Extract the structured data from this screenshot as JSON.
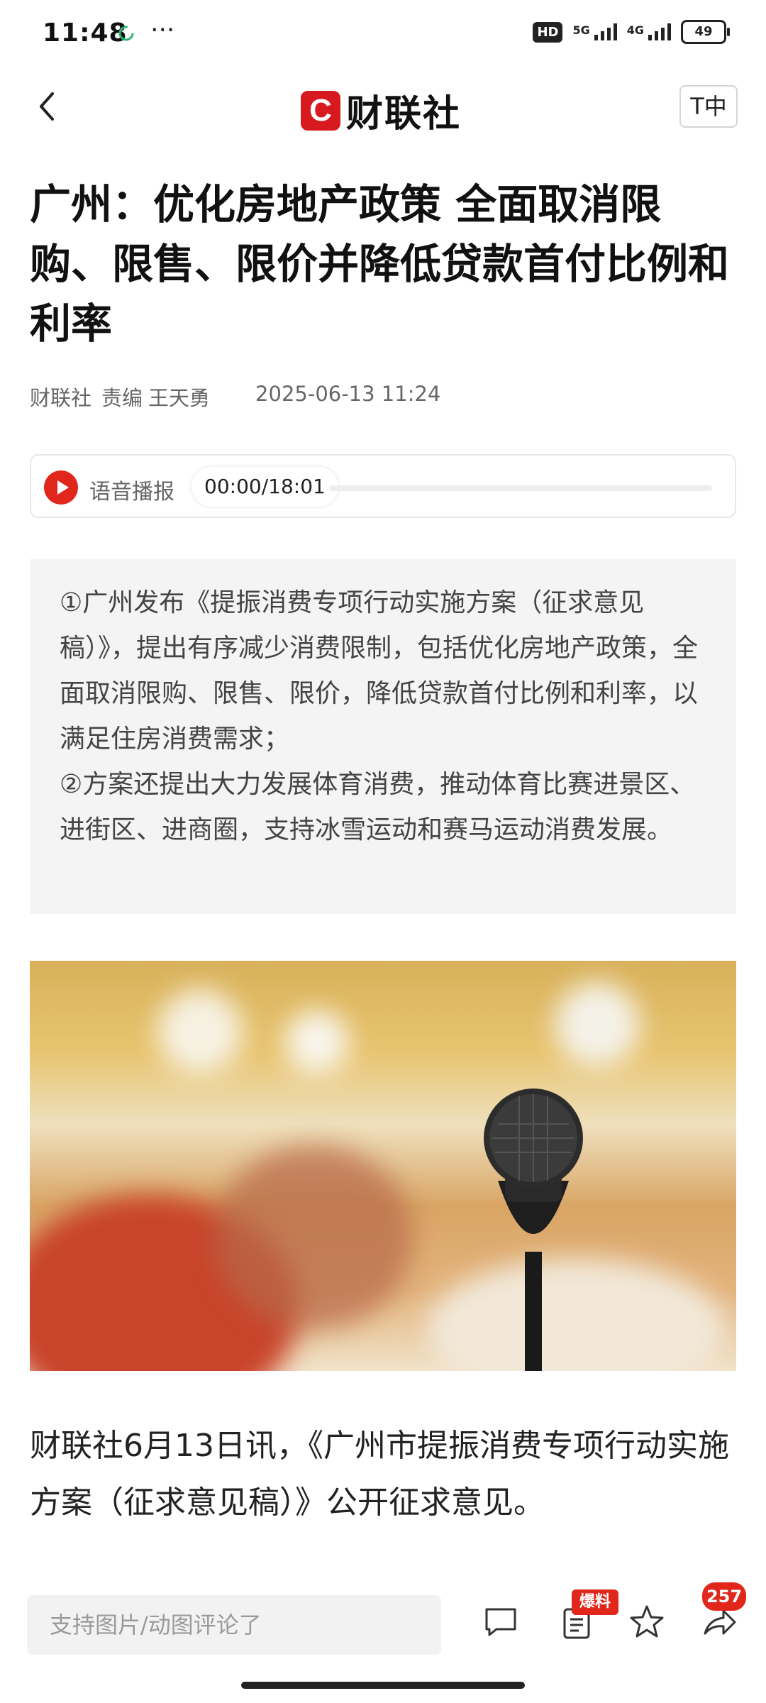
{
  "status_bar": {
    "time": "11:48",
    "dots": "···",
    "hd": "HD",
    "net1": "5G",
    "net2": "4G",
    "battery": "49"
  },
  "header": {
    "logo_mark": "C",
    "logo_text": "财联社",
    "font_button": "T中"
  },
  "article": {
    "title": "广州：优化房地产政策 全面取消限购、限售、限价并降低贷款首付比例和利率",
    "source": "财联社",
    "editor_label": "责编",
    "editor_name": "王天勇",
    "datetime": "2025-06-13 11:24",
    "audio": {
      "label": "语音播报",
      "time": "00:00/18:01",
      "progress": 0
    },
    "summary": [
      "①广州发布《提振消费专项行动实施方案（征求意见稿）》，提出有序减少消费限制，包括优化房地产政策，全面取消限购、限售、限价，降低贷款首付比例和利率，以满足住房消费需求；",
      "②方案还提出大力发展体育消费，推动体育比赛进景区、进街区、进商圈，支持冰雪运动和赛马运动消费发展。"
    ],
    "body": "财联社6月13日讯，《广州市提振消费专项行动实施方案（征求意见稿）》公开征求意见。"
  },
  "bottom_bar": {
    "comment_placeholder": "支持图片/动图评论了",
    "tip_badge": "爆料",
    "share_count": "257"
  }
}
